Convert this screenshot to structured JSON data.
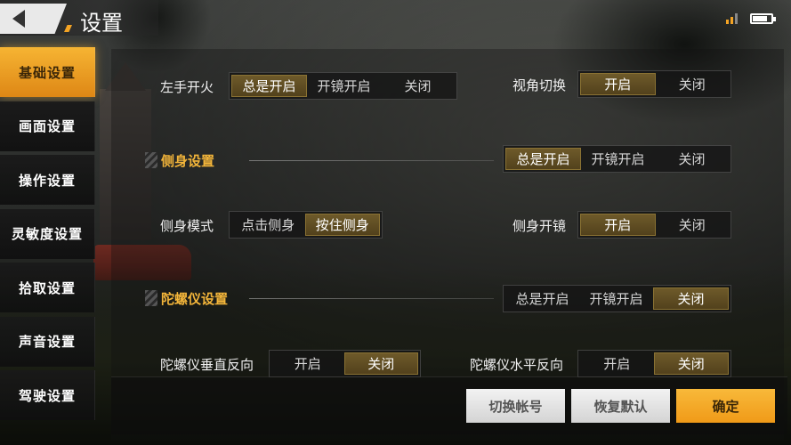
{
  "header": {
    "title": "设置"
  },
  "sidebar": {
    "items": [
      {
        "label": "基础设置",
        "active": true
      },
      {
        "label": "画面设置",
        "active": false
      },
      {
        "label": "操作设置",
        "active": false
      },
      {
        "label": "灵敏度设置",
        "active": false
      },
      {
        "label": "拾取设置",
        "active": false
      },
      {
        "label": "声音设置",
        "active": false
      },
      {
        "label": "驾驶设置",
        "active": false
      }
    ]
  },
  "settings": {
    "left_fire": {
      "label": "左手开火",
      "options": [
        "总是开启",
        "开镜开启",
        "关闭"
      ],
      "selected": 0
    },
    "view_switch": {
      "label": "视角切换",
      "options": [
        "开启",
        "关闭"
      ],
      "selected": 0
    },
    "lean_section": {
      "title": "侧身设置",
      "options": [
        "总是开启",
        "开镜开启",
        "关闭"
      ],
      "selected": 0
    },
    "lean_mode": {
      "label": "侧身模式",
      "options": [
        "点击侧身",
        "按住侧身"
      ],
      "selected": 1
    },
    "lean_scope": {
      "label": "侧身开镜",
      "options": [
        "开启",
        "关闭"
      ],
      "selected": 0
    },
    "gyro_section": {
      "title": "陀螺仪设置",
      "options": [
        "总是开启",
        "开镜开启",
        "关闭"
      ],
      "selected": 2
    },
    "gyro_vertical": {
      "label": "陀螺仪垂直反向",
      "options": [
        "开启",
        "关闭"
      ],
      "selected": 1
    },
    "gyro_horizontal": {
      "label": "陀螺仪水平反向",
      "options": [
        "开启",
        "关闭"
      ],
      "selected": 1
    }
  },
  "footer": {
    "switch_account": "切换帐号",
    "restore_default": "恢复默认",
    "confirm": "确定"
  },
  "colors": {
    "accent": "#f3a324",
    "selected_segment": "#5e4b21",
    "section_title": "#f3b53a"
  }
}
